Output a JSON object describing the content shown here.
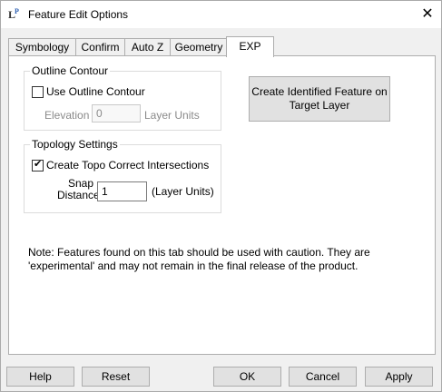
{
  "window": {
    "title": "Feature Edit Options",
    "close_glyph": "✕",
    "icon": {
      "text": "LP",
      "name": "lp-app-icon"
    }
  },
  "tabs": [
    {
      "label": "Symbology",
      "active": false
    },
    {
      "label": "Confirm",
      "active": false
    },
    {
      "label": "Auto Z",
      "active": false
    },
    {
      "label": "Geometry",
      "active": false
    },
    {
      "label": "EXP",
      "active": true
    }
  ],
  "outline_contour": {
    "group_label": "Outline Contour",
    "use_label": "Use Outline Contour",
    "use_checked": false,
    "elevation_label": "Elevation",
    "elevation_value": "0",
    "elevation_units": "Layer Units"
  },
  "create_feature_button": {
    "line1": "Create Identified Feature on",
    "line2": "Target Layer"
  },
  "topology": {
    "group_label": "Topology Settings",
    "create_topo_label": "Create Topo Correct Intersections",
    "create_topo_checked": true,
    "check_glyph": "✔",
    "snap_label_line1": "Snap",
    "snap_label_line2": "Distance:",
    "snap_value": "1",
    "snap_units": "(Layer Units)"
  },
  "note": {
    "line1": "Note:  Features found on this tab should be used with caution.  They are",
    "line2": "'experimental' and may not remain in the final release of the product."
  },
  "footer": {
    "help": "Help",
    "reset": "Reset",
    "ok": "OK",
    "cancel": "Cancel",
    "apply": "Apply"
  }
}
